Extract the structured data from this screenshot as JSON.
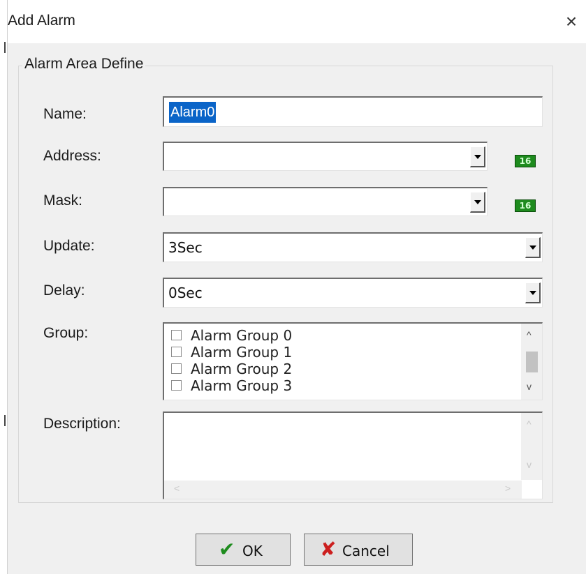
{
  "dialog": {
    "title": "Add Alarm",
    "close_glyph": "×"
  },
  "group": {
    "legend": "Alarm Area Define"
  },
  "fields": {
    "name": {
      "label": "Name:",
      "value": "Alarm0"
    },
    "address": {
      "label": "Address:",
      "value": "",
      "badge": "16"
    },
    "mask": {
      "label": "Mask:",
      "value": "",
      "badge": "16"
    },
    "update": {
      "label": "Update:",
      "value": "3Sec"
    },
    "delay": {
      "label": "Delay:",
      "value": "0Sec"
    },
    "group": {
      "label": "Group:",
      "items": [
        "Alarm Group 0",
        "Alarm Group 1",
        "Alarm Group 2",
        "Alarm Group 3"
      ],
      "checked": [
        false,
        false,
        false,
        false
      ]
    },
    "description": {
      "label": "Description:",
      "value": ""
    }
  },
  "scroll": {
    "up": "^",
    "down": "v",
    "left": "<",
    "right": ">"
  },
  "buttons": {
    "ok": {
      "label": "OK",
      "icon": "checkmark-icon",
      "color": "#1e8c1e"
    },
    "cancel": {
      "label": "Cancel",
      "icon": "x-icon",
      "color": "#cc1f1f"
    }
  }
}
